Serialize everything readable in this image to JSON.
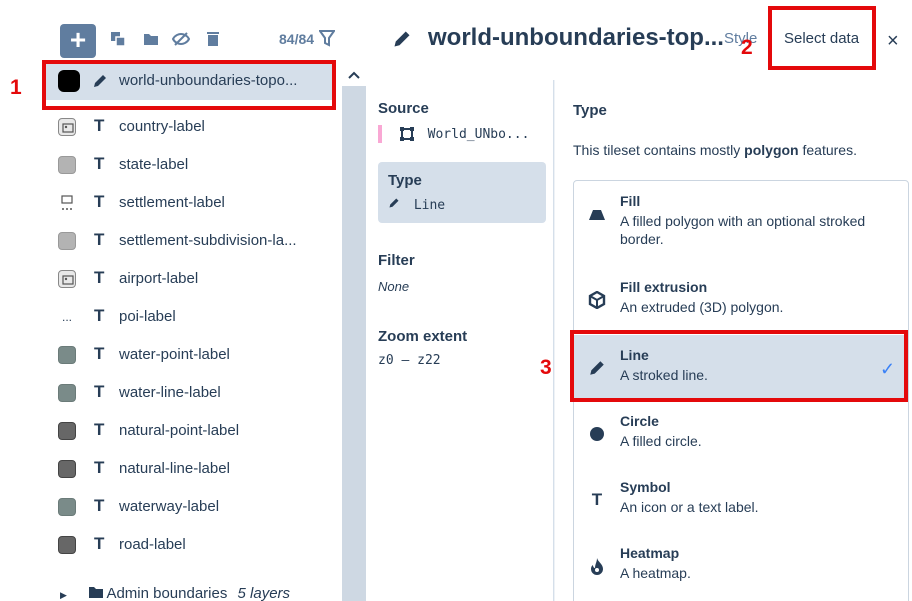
{
  "toolbar": {
    "add_label": "+",
    "count": "84/84"
  },
  "layers": [
    {
      "label": "world-unboundaries-topo...",
      "swatch": "black",
      "icon": "pencil-icon",
      "selected": true
    },
    {
      "label": "country-label",
      "swatch": "image",
      "icon": "T"
    },
    {
      "label": "state-label",
      "swatch": "grey",
      "icon": "T"
    },
    {
      "label": "settlement-label",
      "swatch": "image-dots",
      "icon": "T"
    },
    {
      "label": "settlement-subdivision-la...",
      "swatch": "grey",
      "icon": "T"
    },
    {
      "label": "airport-label",
      "swatch": "image",
      "icon": "T"
    },
    {
      "label": "poi-label",
      "swatch": "dots",
      "icon": "T"
    },
    {
      "label": "water-point-label",
      "swatch": "slate",
      "icon": "T"
    },
    {
      "label": "water-line-label",
      "swatch": "slate",
      "icon": "T"
    },
    {
      "label": "natural-point-label",
      "swatch": "dark",
      "icon": "T"
    },
    {
      "label": "natural-line-label",
      "swatch": "dark",
      "icon": "T"
    },
    {
      "label": "waterway-label",
      "swatch": "slate",
      "icon": "T"
    },
    {
      "label": "road-label",
      "swatch": "dark",
      "icon": "T"
    }
  ],
  "t_glyph": "T",
  "dots_glyph": "...",
  "folder": {
    "label": "Admin boundaries",
    "sublabel": "5 layers"
  },
  "editor": {
    "title": "world-unboundaries-top...",
    "tab_style": "Style",
    "tab_select": "Select data",
    "close": "×",
    "source_heading": "Source",
    "source_value": "World_UNbo...",
    "type_heading": "Type",
    "type_value": "Line",
    "filter_heading": "Filter",
    "filter_value": "None",
    "zoom_heading": "Zoom extent",
    "zoom_value": "z0 – z22",
    "right_title": "Type",
    "right_desc_pre": "This tileset contains mostly ",
    "right_desc_bold": "polygon",
    "right_desc_post": " features.",
    "options": [
      {
        "title": "Fill",
        "desc": "A filled polygon with an optional stroked border.",
        "icon": "fill-icon"
      },
      {
        "title": "Fill extrusion",
        "desc": "An extruded (3D) polygon.",
        "icon": "cube-icon"
      },
      {
        "title": "Line",
        "desc": "A stroked line.",
        "icon": "pencil-icon",
        "selected": true
      },
      {
        "title": "Circle",
        "desc": "A filled circle.",
        "icon": "circle-icon"
      },
      {
        "title": "Symbol",
        "desc": "An icon or a text label.",
        "icon": "text-icon"
      },
      {
        "title": "Heatmap",
        "desc": "A heatmap.",
        "icon": "flame-icon"
      }
    ],
    "check": "✓"
  },
  "annotations": {
    "n1": "1",
    "n2": "2",
    "n3": "3"
  },
  "colors": {
    "accent": "#607d9f",
    "selected_bg": "#d5dfea",
    "callout": "#e4090b",
    "check": "#3b82f6"
  }
}
